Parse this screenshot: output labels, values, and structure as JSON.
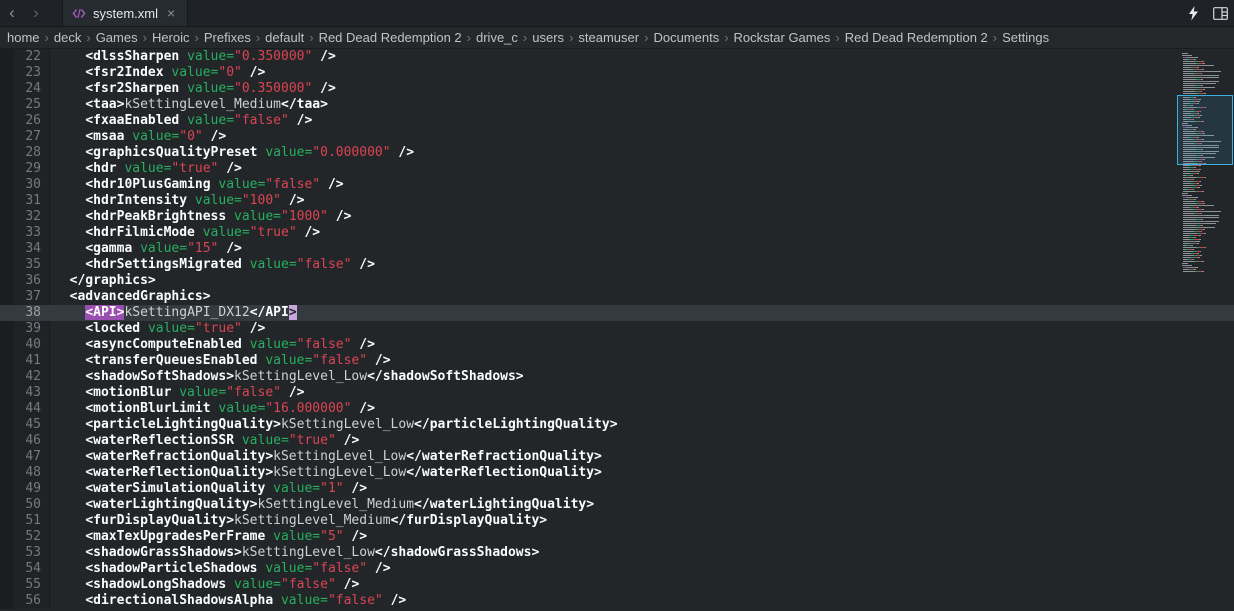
{
  "tab_bar": {
    "back_glyph": "‹",
    "forward_glyph": "›",
    "tab_title": "system.xml",
    "close_glyph": "×",
    "action_icons": [
      "lightning",
      "panel-grid"
    ]
  },
  "breadcrumb": {
    "separator": "›",
    "items": [
      "home",
      "deck",
      "Games",
      "Heroic",
      "Prefixes",
      "default",
      "Red Dead Redemption 2",
      "drive_c",
      "users",
      "steamuser",
      "Documents",
      "Rockstar Games",
      "Red Dead Redemption 2",
      "Settings"
    ]
  },
  "colors": {
    "tag": "#fcfcfc",
    "attribute": "#27ae60",
    "string": "#da4453",
    "selection_highlight": "#9a4fb0",
    "current_line": "#333a40",
    "viewport_outline": "#3daee2"
  },
  "editor": {
    "current_line": 38,
    "lines": [
      {
        "num": 22,
        "indent": 4,
        "tokens": [
          [
            "tag",
            "<dlssSharpen "
          ],
          [
            "attr",
            "value="
          ],
          [
            "str",
            "\"0.350000\""
          ],
          [
            "tag",
            " />"
          ]
        ]
      },
      {
        "num": 23,
        "indent": 4,
        "tokens": [
          [
            "tag",
            "<fsr2Index "
          ],
          [
            "attr",
            "value="
          ],
          [
            "str",
            "\"0\""
          ],
          [
            "tag",
            " />"
          ]
        ]
      },
      {
        "num": 24,
        "indent": 4,
        "tokens": [
          [
            "tag",
            "<fsr2Sharpen "
          ],
          [
            "attr",
            "value="
          ],
          [
            "str",
            "\"0.350000\""
          ],
          [
            "tag",
            " />"
          ]
        ]
      },
      {
        "num": 25,
        "indent": 4,
        "tokens": [
          [
            "tag",
            "<taa>"
          ],
          [
            "text",
            "kSettingLevel_Medium"
          ],
          [
            "tag",
            "</taa>"
          ]
        ]
      },
      {
        "num": 26,
        "indent": 4,
        "tokens": [
          [
            "tag",
            "<fxaaEnabled "
          ],
          [
            "attr",
            "value="
          ],
          [
            "str",
            "\"false\""
          ],
          [
            "tag",
            " />"
          ]
        ]
      },
      {
        "num": 27,
        "indent": 4,
        "tokens": [
          [
            "tag",
            "<msaa "
          ],
          [
            "attr",
            "value="
          ],
          [
            "str",
            "\"0\""
          ],
          [
            "tag",
            " />"
          ]
        ]
      },
      {
        "num": 28,
        "indent": 4,
        "tokens": [
          [
            "tag",
            "<graphicsQualityPreset "
          ],
          [
            "attr",
            "value="
          ],
          [
            "str",
            "\"0.000000\""
          ],
          [
            "tag",
            " />"
          ]
        ]
      },
      {
        "num": 29,
        "indent": 4,
        "tokens": [
          [
            "tag",
            "<hdr "
          ],
          [
            "attr",
            "value="
          ],
          [
            "str",
            "\"true\""
          ],
          [
            "tag",
            " />"
          ]
        ]
      },
      {
        "num": 30,
        "indent": 4,
        "tokens": [
          [
            "tag",
            "<hdr10PlusGaming "
          ],
          [
            "attr",
            "value="
          ],
          [
            "str",
            "\"false\""
          ],
          [
            "tag",
            " />"
          ]
        ]
      },
      {
        "num": 31,
        "indent": 4,
        "tokens": [
          [
            "tag",
            "<hdrIntensity "
          ],
          [
            "attr",
            "value="
          ],
          [
            "str",
            "\"100\""
          ],
          [
            "tag",
            " />"
          ]
        ]
      },
      {
        "num": 32,
        "indent": 4,
        "tokens": [
          [
            "tag",
            "<hdrPeakBrightness "
          ],
          [
            "attr",
            "value="
          ],
          [
            "str",
            "\"1000\""
          ],
          [
            "tag",
            " />"
          ]
        ]
      },
      {
        "num": 33,
        "indent": 4,
        "tokens": [
          [
            "tag",
            "<hdrFilmicMode "
          ],
          [
            "attr",
            "value="
          ],
          [
            "str",
            "\"true\""
          ],
          [
            "tag",
            " />"
          ]
        ]
      },
      {
        "num": 34,
        "indent": 4,
        "tokens": [
          [
            "tag",
            "<gamma "
          ],
          [
            "attr",
            "value="
          ],
          [
            "str",
            "\"15\""
          ],
          [
            "tag",
            " />"
          ]
        ]
      },
      {
        "num": 35,
        "indent": 4,
        "tokens": [
          [
            "tag",
            "<hdrSettingsMigrated "
          ],
          [
            "attr",
            "value="
          ],
          [
            "str",
            "\"false\""
          ],
          [
            "tag",
            " />"
          ]
        ]
      },
      {
        "num": 36,
        "indent": 2,
        "tokens": [
          [
            "tag",
            "</graphics>"
          ]
        ]
      },
      {
        "num": 37,
        "indent": 2,
        "tokens": [
          [
            "tag",
            "<advancedGraphics>"
          ]
        ]
      },
      {
        "num": 38,
        "indent": 4,
        "tokens": [
          [
            "hl",
            "<API>"
          ],
          [
            "text",
            "kSettingAPI_DX12"
          ],
          [
            "tag",
            "</API"
          ],
          [
            "cursor",
            ">"
          ]
        ]
      },
      {
        "num": 39,
        "indent": 4,
        "tokens": [
          [
            "tag",
            "<locked "
          ],
          [
            "attr",
            "value="
          ],
          [
            "str",
            "\"true\""
          ],
          [
            "tag",
            " />"
          ]
        ]
      },
      {
        "num": 40,
        "indent": 4,
        "tokens": [
          [
            "tag",
            "<asyncComputeEnabled "
          ],
          [
            "attr",
            "value="
          ],
          [
            "str",
            "\"false\""
          ],
          [
            "tag",
            " />"
          ]
        ]
      },
      {
        "num": 41,
        "indent": 4,
        "tokens": [
          [
            "tag",
            "<transferQueuesEnabled "
          ],
          [
            "attr",
            "value="
          ],
          [
            "str",
            "\"false\""
          ],
          [
            "tag",
            " />"
          ]
        ]
      },
      {
        "num": 42,
        "indent": 4,
        "tokens": [
          [
            "tag",
            "<shadowSoftShadows>"
          ],
          [
            "text",
            "kSettingLevel_Low"
          ],
          [
            "tag",
            "</shadowSoftShadows>"
          ]
        ]
      },
      {
        "num": 43,
        "indent": 4,
        "tokens": [
          [
            "tag",
            "<motionBlur "
          ],
          [
            "attr",
            "value="
          ],
          [
            "str",
            "\"false\""
          ],
          [
            "tag",
            " />"
          ]
        ]
      },
      {
        "num": 44,
        "indent": 4,
        "tokens": [
          [
            "tag",
            "<motionBlurLimit "
          ],
          [
            "attr",
            "value="
          ],
          [
            "str",
            "\"16.000000\""
          ],
          [
            "tag",
            " />"
          ]
        ]
      },
      {
        "num": 45,
        "indent": 4,
        "tokens": [
          [
            "tag",
            "<particleLightingQuality>"
          ],
          [
            "text",
            "kSettingLevel_Low"
          ],
          [
            "tag",
            "</particleLightingQuality>"
          ]
        ]
      },
      {
        "num": 46,
        "indent": 4,
        "tokens": [
          [
            "tag",
            "<waterReflectionSSR "
          ],
          [
            "attr",
            "value="
          ],
          [
            "str",
            "\"true\""
          ],
          [
            "tag",
            " />"
          ]
        ]
      },
      {
        "num": 47,
        "indent": 4,
        "tokens": [
          [
            "tag",
            "<waterRefractionQuality>"
          ],
          [
            "text",
            "kSettingLevel_Low"
          ],
          [
            "tag",
            "</waterRefractionQuality>"
          ]
        ]
      },
      {
        "num": 48,
        "indent": 4,
        "tokens": [
          [
            "tag",
            "<waterReflectionQuality>"
          ],
          [
            "text",
            "kSettingLevel_Low"
          ],
          [
            "tag",
            "</waterReflectionQuality>"
          ]
        ]
      },
      {
        "num": 49,
        "indent": 4,
        "tokens": [
          [
            "tag",
            "<waterSimulationQuality "
          ],
          [
            "attr",
            "value="
          ],
          [
            "str",
            "\"1\""
          ],
          [
            "tag",
            " />"
          ]
        ]
      },
      {
        "num": 50,
        "indent": 4,
        "tokens": [
          [
            "tag",
            "<waterLightingQuality>"
          ],
          [
            "text",
            "kSettingLevel_Medium"
          ],
          [
            "tag",
            "</waterLightingQuality>"
          ]
        ]
      },
      {
        "num": 51,
        "indent": 4,
        "tokens": [
          [
            "tag",
            "<furDisplayQuality>"
          ],
          [
            "text",
            "kSettingLevel_Medium"
          ],
          [
            "tag",
            "</furDisplayQuality>"
          ]
        ]
      },
      {
        "num": 52,
        "indent": 4,
        "tokens": [
          [
            "tag",
            "<maxTexUpgradesPerFrame "
          ],
          [
            "attr",
            "value="
          ],
          [
            "str",
            "\"5\""
          ],
          [
            "tag",
            " />"
          ]
        ]
      },
      {
        "num": 53,
        "indent": 4,
        "tokens": [
          [
            "tag",
            "<shadowGrassShadows>"
          ],
          [
            "text",
            "kSettingLevel_Low"
          ],
          [
            "tag",
            "</shadowGrassShadows>"
          ]
        ]
      },
      {
        "num": 54,
        "indent": 4,
        "tokens": [
          [
            "tag",
            "<shadowParticleShadows "
          ],
          [
            "attr",
            "value="
          ],
          [
            "str",
            "\"false\""
          ],
          [
            "tag",
            " />"
          ]
        ]
      },
      {
        "num": 55,
        "indent": 4,
        "tokens": [
          [
            "tag",
            "<shadowLongShadows "
          ],
          [
            "attr",
            "value="
          ],
          [
            "str",
            "\"false\""
          ],
          [
            "tag",
            " />"
          ]
        ]
      },
      {
        "num": 56,
        "indent": 4,
        "tokens": [
          [
            "tag",
            "<directionalShadowsAlpha "
          ],
          [
            "attr",
            "value="
          ],
          [
            "str",
            "\"false\""
          ],
          [
            "tag",
            " />"
          ]
        ]
      }
    ]
  }
}
